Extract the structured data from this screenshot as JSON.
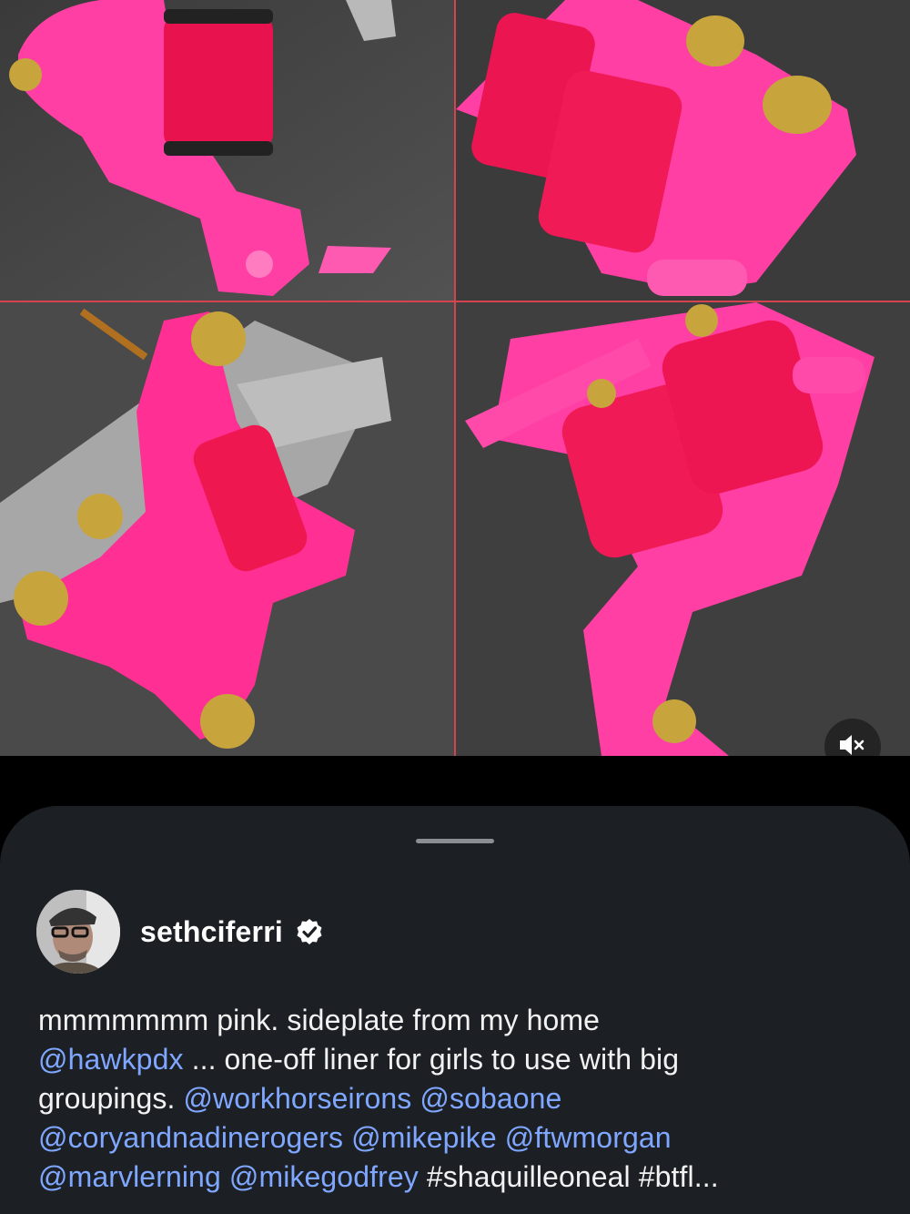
{
  "post": {
    "username": "sethciferri",
    "verified": true,
    "caption_lines": [
      [
        {
          "text": "mmmmmmm pink. sideplate from my home",
          "type": "text"
        }
      ],
      [
        {
          "text": "@hawkpdx",
          "type": "mention"
        },
        {
          "text": " ... one-off liner for girls to use with big",
          "type": "text"
        }
      ],
      [
        {
          "text": "groupings. ",
          "type": "text"
        },
        {
          "text": "@workhorseirons",
          "type": "mention"
        },
        {
          "text": " ",
          "type": "text"
        },
        {
          "text": "@sobaone",
          "type": "mention"
        }
      ],
      [
        {
          "text": "@coryandnadinerogers",
          "type": "mention"
        },
        {
          "text": " ",
          "type": "text"
        },
        {
          "text": "@mikepike",
          "type": "mention"
        },
        {
          "text": " ",
          "type": "text"
        },
        {
          "text": "@ftwmorgan",
          "type": "mention"
        }
      ],
      [
        {
          "text": "@marvlerning",
          "type": "mention"
        },
        {
          "text": " ",
          "type": "text"
        },
        {
          "text": "@mikegodfrey",
          "type": "mention"
        },
        {
          "text": " #shaquilleoneal #btfl...",
          "type": "text"
        }
      ]
    ]
  },
  "media": {
    "tiles": [
      "tattoo-machine-photo-1",
      "tattoo-machine-photo-2",
      "tattoo-machine-photo-3",
      "tattoo-machine-photo-4"
    ],
    "mute_icon": "speaker-muted-icon"
  },
  "colors": {
    "machine_pink": "#ff3fa4",
    "coil_red": "#f2174f",
    "brass": "#c8a43c",
    "sheet_bg": "#1c2024",
    "mention": "#7fa7ff"
  }
}
